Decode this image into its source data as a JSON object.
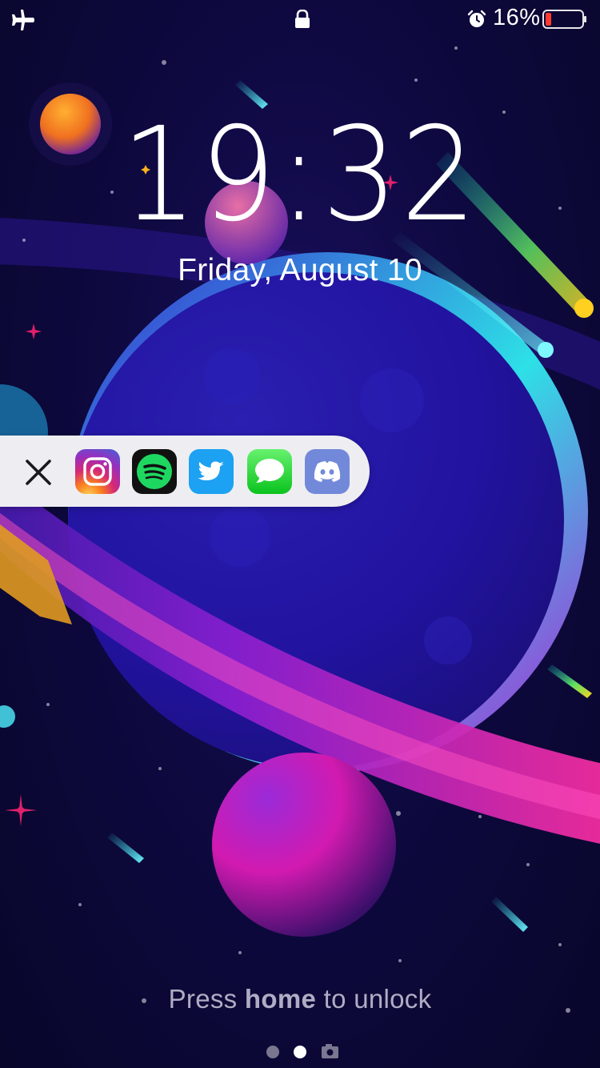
{
  "status_bar": {
    "airplane_icon": "airplane-icon",
    "lock_icon": "lock-icon",
    "alarm_icon": "alarm-icon",
    "battery_percent": "16%",
    "battery_level": 0.16,
    "battery_color": "#ff3b30"
  },
  "lock_screen": {
    "time": "19:32",
    "date": "Friday, August 10"
  },
  "shortcut_bar": {
    "close_icon": "close-icon",
    "apps": [
      {
        "name": "Instagram",
        "icon": "instagram-icon"
      },
      {
        "name": "Spotify",
        "icon": "spotify-icon"
      },
      {
        "name": "Twitter",
        "icon": "twitter-icon"
      },
      {
        "name": "Messages",
        "icon": "messages-icon"
      },
      {
        "name": "Discord",
        "icon": "discord-icon"
      }
    ]
  },
  "unlock_hint": {
    "prefix": "Press ",
    "bold": "home",
    "suffix": " to unlock"
  },
  "page_indicator": {
    "pages": 2,
    "current_page": 2,
    "camera_icon": "camera-icon"
  }
}
